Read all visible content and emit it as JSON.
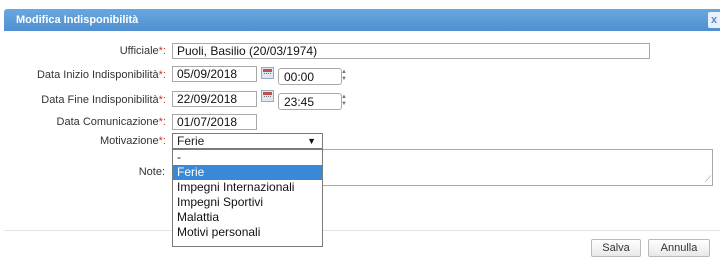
{
  "dialog": {
    "title": "Modifica Indisponibilità",
    "close_symbol": "x"
  },
  "form": {
    "ufficiale": {
      "label": "Ufficiale",
      "required_mark": "*:",
      "value": "Puoli, Basilio (20/03/1974)"
    },
    "data_inizio": {
      "label": "Data Inizio Indisponibilità",
      "required_mark": "*:",
      "date": "05/09/2018",
      "time": "00:00"
    },
    "data_fine": {
      "label": "Data Fine Indisponibilità",
      "required_mark": "*:",
      "date": "22/09/2018",
      "time": "23:45"
    },
    "data_comunicazione": {
      "label": "Data Comunicazione",
      "required_mark": "*:",
      "value": "01/07/2018"
    },
    "motivazione": {
      "label": "Motivazione",
      "required_mark": "*:",
      "selected": "Ferie",
      "options": [
        "-",
        "Ferie",
        "Impegni Internazionali",
        "Impegni Sportivi",
        "Malattia",
        "Motivi personali"
      ]
    },
    "note": {
      "label": "Note:",
      "value": ""
    }
  },
  "buttons": {
    "save": "Salva",
    "cancel": "Annulla"
  },
  "colors": {
    "titlebar": "#4f8fd0",
    "required": "#c0392b",
    "highlight": "#3a88d8"
  }
}
